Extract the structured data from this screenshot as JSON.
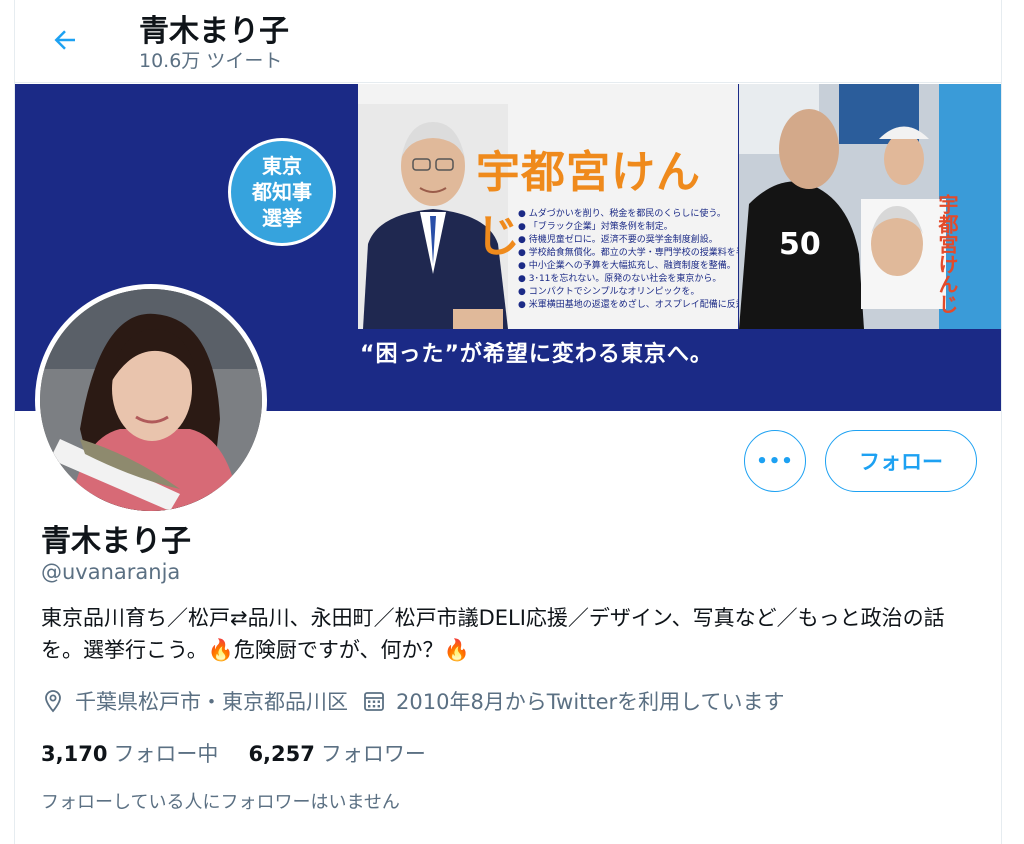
{
  "header": {
    "title": "青木まり子",
    "tweet_count": "10.6万 ツイート"
  },
  "banner": {
    "badge_lines": [
      "東京",
      "都知事",
      "選挙"
    ],
    "candidate_name": "宇都宮けんじ",
    "policies": [
      "ムダづかいを削り、税金を都民のくらしに使う。",
      "「ブラック企業」対策条例を制定。",
      "待機児童ゼロに。返済不要の奨学金制度創設。",
      "学校給食無償化。都立の大学・専門学校の授業料を半額に。",
      "中小企業への予算を大幅拡充し、融資制度を整備。",
      "3･11を忘れない。原発のない社会を東京から。",
      "コンパクトでシンプルなオリンピックを。",
      "米軍横田基地の返還をめざし、オスプレイ配備に反対。"
    ],
    "slogan": "“困った”が希望に変わる東京へ。",
    "side_sign": "宇都宮けんじ",
    "shirt_number": "50"
  },
  "actions": {
    "more_label": "•••",
    "follow_label": "フォロー"
  },
  "profile": {
    "name": "青木まり子",
    "handle": "@uvanaranja",
    "bio": "東京品川育ち／松戸⇄品川、永田町／松戸市議DELI応援／デザイン、写真など／もっと政治の話を。選挙行こう。🔥危険厨ですが、何か？🔥",
    "location": "千葉県松戸市・東京都品川区",
    "joined": "2010年8月からTwitterを利用しています"
  },
  "stats": {
    "following_count": "3,170",
    "following_label": "フォロー中",
    "followers_count": "6,257",
    "followers_label": "フォロワー"
  },
  "note": "フォローしている人にフォロワーはいません",
  "colors": {
    "accent": "#1da1f2",
    "banner_navy": "#1b2a86",
    "badge_blue": "#36a3dd",
    "candidate_orange": "#ef8a1c"
  }
}
